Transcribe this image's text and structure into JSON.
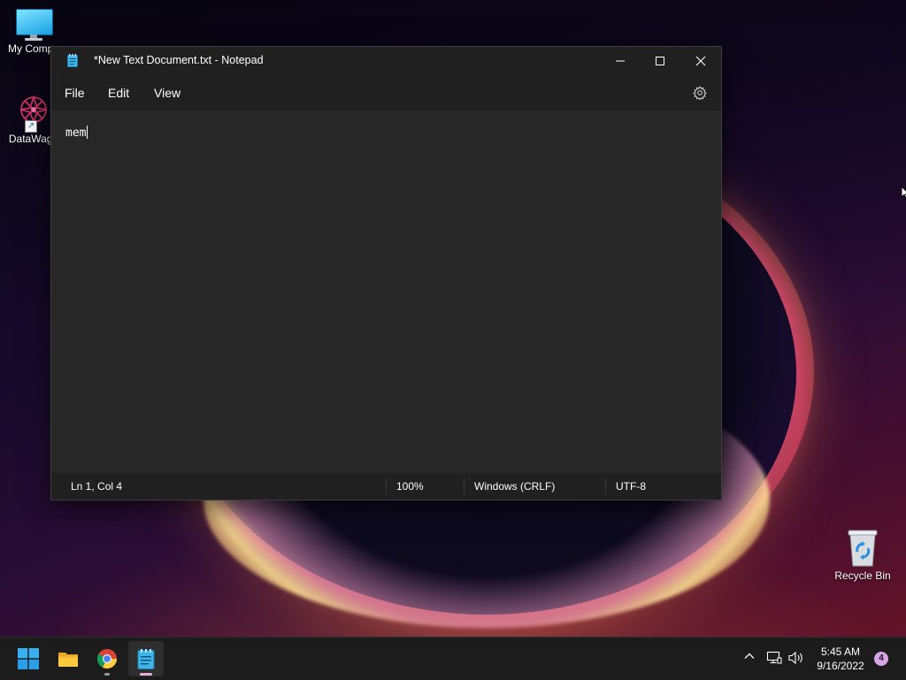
{
  "desktop": {
    "icons": [
      {
        "label": "My Compu",
        "icon": "monitor-icon"
      },
      {
        "label": "DataWago",
        "icon": "datawagon-icon"
      },
      {
        "label": "Recycle Bin",
        "icon": "recycle-bin-icon"
      }
    ]
  },
  "window": {
    "title": "*New Text Document.txt - Notepad",
    "app_icon": "notepad-icon",
    "controls": {
      "minimize": "minimize-icon",
      "maximize": "maximize-icon",
      "close": "close-icon"
    }
  },
  "menu": {
    "items": [
      {
        "label": "File"
      },
      {
        "label": "Edit"
      },
      {
        "label": "View"
      }
    ],
    "settings_icon": "gear-icon"
  },
  "editor": {
    "content": "mem"
  },
  "status": {
    "position": "Ln 1, Col 4",
    "zoom": "100%",
    "line_ending": "Windows (CRLF)",
    "encoding": "UTF-8"
  },
  "taskbar": {
    "apps": [
      {
        "name": "start",
        "icon": "windows-start-icon"
      },
      {
        "name": "file-explorer",
        "icon": "folder-icon"
      },
      {
        "name": "chrome",
        "icon": "chrome-icon"
      },
      {
        "name": "notepad",
        "icon": "notepad-icon",
        "active": true
      }
    ],
    "tray": {
      "icons": [
        "chevron-up-icon",
        "network-icon",
        "volume-icon"
      ],
      "time": "5:45 AM",
      "date": "9/16/2022",
      "notifications": "4"
    }
  },
  "colors": {
    "window_bg": "#272727",
    "chrome_bg": "#202020",
    "taskbar_bg": "#1c1c1c",
    "accent": "#0078d4"
  }
}
